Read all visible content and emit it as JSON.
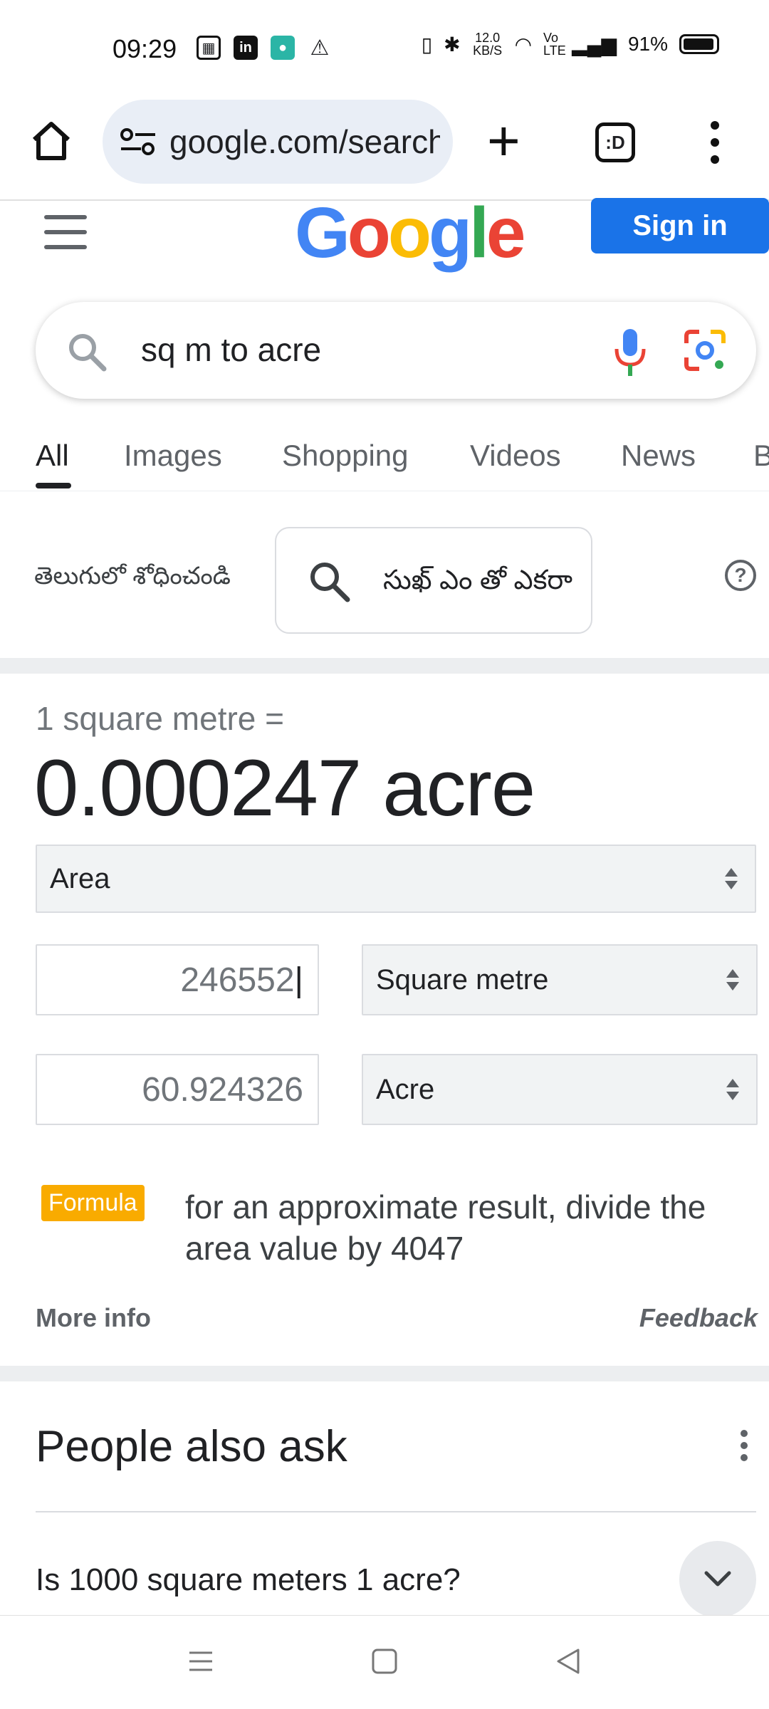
{
  "status_bar": {
    "time": "09:29",
    "network_speed": "12.0 KB/S",
    "volte": "Vo LTE",
    "battery": "91%"
  },
  "browser": {
    "url": "google.com/search",
    "tabs_label": ":D"
  },
  "google": {
    "logo": "Google",
    "sign_in": "Sign in",
    "search_query": "sq m to acre"
  },
  "tabs": [
    {
      "label": "All"
    },
    {
      "label": "Images"
    },
    {
      "label": "Shopping"
    },
    {
      "label": "Videos"
    },
    {
      "label": "News"
    },
    {
      "label": "B"
    }
  ],
  "telugu": {
    "label": "తెలుగులో శోధించండి",
    "query": "సుఖ్ ఎం తో ఎకరా"
  },
  "converter": {
    "lead": "1 square metre =",
    "result": "0.000247 acre",
    "category": "Area",
    "from_value": "246552",
    "from_unit": "Square metre",
    "to_value": "60.924326",
    "to_unit": "Acre",
    "formula_badge": "Formula",
    "formula_text": "for an approximate result, divide the area value by 4047",
    "more_info": "More info",
    "feedback": "Feedback"
  },
  "people_also_ask": {
    "title": "People also ask",
    "questions": [
      {
        "text": "Is 1000 square meters 1 acre?"
      }
    ]
  },
  "colors": {
    "google_blue": "#1a73e8",
    "formula_orange": "#f9ab00"
  }
}
